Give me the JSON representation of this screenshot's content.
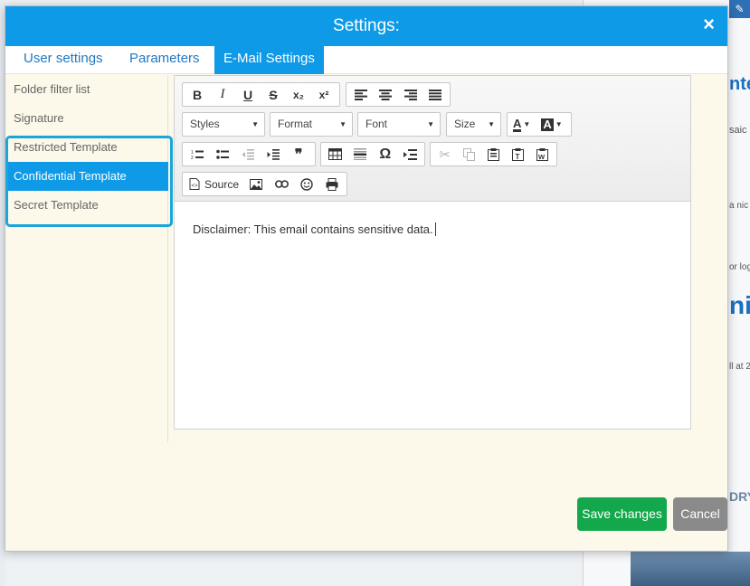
{
  "modal": {
    "title": "Settings:",
    "close_glyph": "×"
  },
  "tabs": [
    {
      "label": "User settings",
      "active": false
    },
    {
      "label": "Parameters",
      "active": false
    },
    {
      "label": "E-Mail Settings",
      "active": true
    }
  ],
  "sidebar": {
    "items": [
      {
        "label": "Folder filter list",
        "active": false
      },
      {
        "label": "Signature",
        "active": false
      },
      {
        "label": "Restricted Template",
        "active": false
      },
      {
        "label": "Confidential Template",
        "active": true
      },
      {
        "label": "Secret Template",
        "active": false
      }
    ]
  },
  "toolbar": {
    "bold": "B",
    "italic": "I",
    "underline": "U",
    "strike": "S",
    "subscript": "x₂",
    "superscript": "x²",
    "styles": "Styles",
    "format": "Format",
    "font": "Font",
    "size": "Size",
    "text_color": "A",
    "bg_color": "A",
    "source": "Source",
    "omega": "Ω",
    "quote": "❞"
  },
  "editor": {
    "content": "Disclaimer: This email contains sensitive data."
  },
  "footer": {
    "save_label": "Save changes",
    "cancel_label": "Cancel"
  },
  "background": {
    "snippets": [
      "ntes",
      "saic",
      "a nic",
      "or log",
      "nic",
      "ll at 2",
      "DRY"
    ]
  },
  "colors": {
    "header": "#0e9ae6",
    "save": "#12a84b",
    "cancel": "#8a8a8a",
    "highlight": "#1aa6d9"
  }
}
